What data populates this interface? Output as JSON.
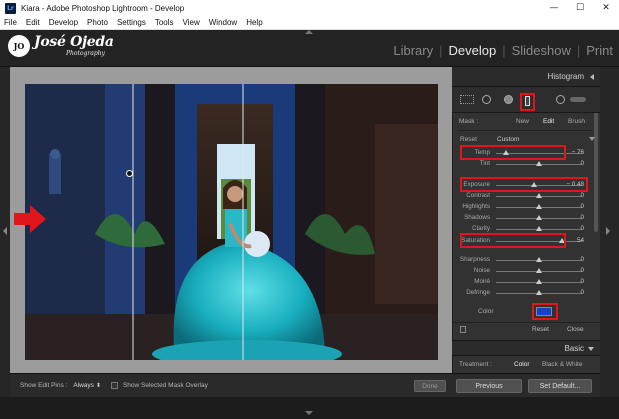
{
  "window": {
    "app_icon": "Lr",
    "title": "Kiara - Adobe Photoshop Lightroom - Develop",
    "controls": [
      "—",
      "☐",
      "✕"
    ]
  },
  "menu": [
    "File",
    "Edit",
    "Develop",
    "Photo",
    "Settings",
    "Tools",
    "View",
    "Window",
    "Help"
  ],
  "identity": {
    "logo_mark": "JO",
    "name": "José Ojeda",
    "sub": "Photography"
  },
  "modules": [
    "Library",
    "Develop",
    "Slideshow",
    "Print"
  ],
  "active_module": "Develop",
  "toolbar": {
    "edit_pins_label": "Show Edit Pins :",
    "edit_pins_value": "Always",
    "mask_overlay_label": "Show Selected Mask Overlay",
    "done_label": "Done"
  },
  "histogram": {
    "title": "Histogram"
  },
  "mask": {
    "label": "Mask :",
    "new": "New",
    "edit": "Edit",
    "brush": "Brush"
  },
  "preset": {
    "label": "Reset",
    "value": "Custom"
  },
  "sliders": [
    {
      "label": "Temp",
      "value": "− 76",
      "pos": 0.12,
      "highlight": true
    },
    {
      "label": "Tint",
      "value": "0",
      "pos": 0.5,
      "highlight": false
    },
    {
      "label": "Exposure",
      "value": "− 0.48",
      "pos": 0.44,
      "highlight": true
    },
    {
      "label": "Contrast",
      "value": "0",
      "pos": 0.5,
      "highlight": false
    },
    {
      "label": "Highlights",
      "value": "0",
      "pos": 0.5,
      "highlight": false
    },
    {
      "label": "Shadows",
      "value": "0",
      "pos": 0.5,
      "highlight": false
    },
    {
      "label": "Clarity",
      "value": "0",
      "pos": 0.5,
      "highlight": false
    },
    {
      "label": "Saturation",
      "value": "54",
      "pos": 0.77,
      "highlight": true
    },
    {
      "label": "Sharpness",
      "value": "0",
      "pos": 0.5,
      "highlight": false
    },
    {
      "label": "Noise",
      "value": "0",
      "pos": 0.5,
      "highlight": false
    },
    {
      "label": "Moiré",
      "value": "0",
      "pos": 0.5,
      "highlight": false
    },
    {
      "label": "Defringe",
      "value": "0",
      "pos": 0.5,
      "highlight": false
    }
  ],
  "color": {
    "label": "Color",
    "swatch": "#1a3fd0"
  },
  "actions": {
    "reset": "Reset",
    "close": "Close"
  },
  "basic": {
    "title": "Basic",
    "treatment_label": "Treatment :",
    "color": "Color",
    "bw": "Black & White"
  },
  "footer": {
    "previous": "Previous",
    "set_default": "Set Default..."
  },
  "accent": "#e0161c"
}
